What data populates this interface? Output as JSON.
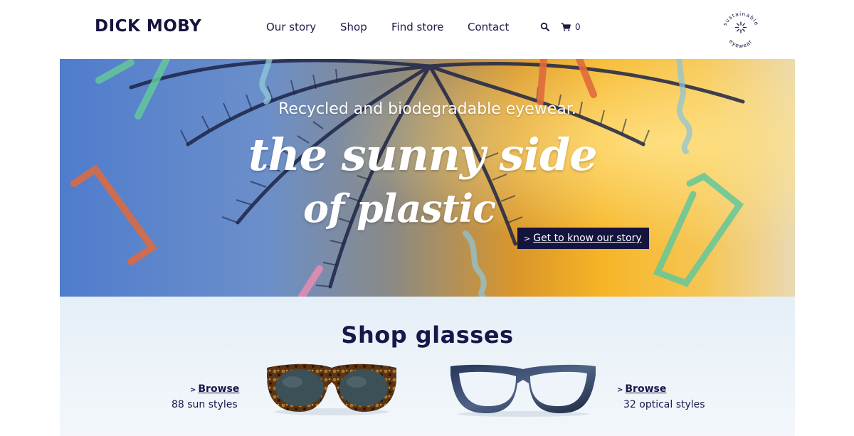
{
  "brand": {
    "name": "DICK MOBY"
  },
  "nav": [
    {
      "label": "Our story"
    },
    {
      "label": "Shop"
    },
    {
      "label": "Find store"
    },
    {
      "label": "Contact"
    }
  ],
  "cart": {
    "count": "0"
  },
  "badge": {
    "text_top": "sustainable",
    "text_bottom": "eyewear"
  },
  "hero": {
    "subtitle": "Recycled and biodegradable eyewear.",
    "script_line1": "the sunny side",
    "script_line2": "of plastic",
    "cta_label": "Get to know our story"
  },
  "shop": {
    "title": "Shop glasses",
    "sun": {
      "browse_label": "Browse",
      "styles_text": "88 sun styles"
    },
    "optical": {
      "browse_label": "Browse",
      "styles_text": "32 optical styles"
    }
  },
  "icons": [
    "search-icon",
    "cart-icon",
    "sun-emblem-icon",
    "chevron-right-icon"
  ],
  "colors": {
    "navy": "#14143f",
    "cta_bg": "#14143f",
    "shop_bg": "#e5eff7"
  }
}
